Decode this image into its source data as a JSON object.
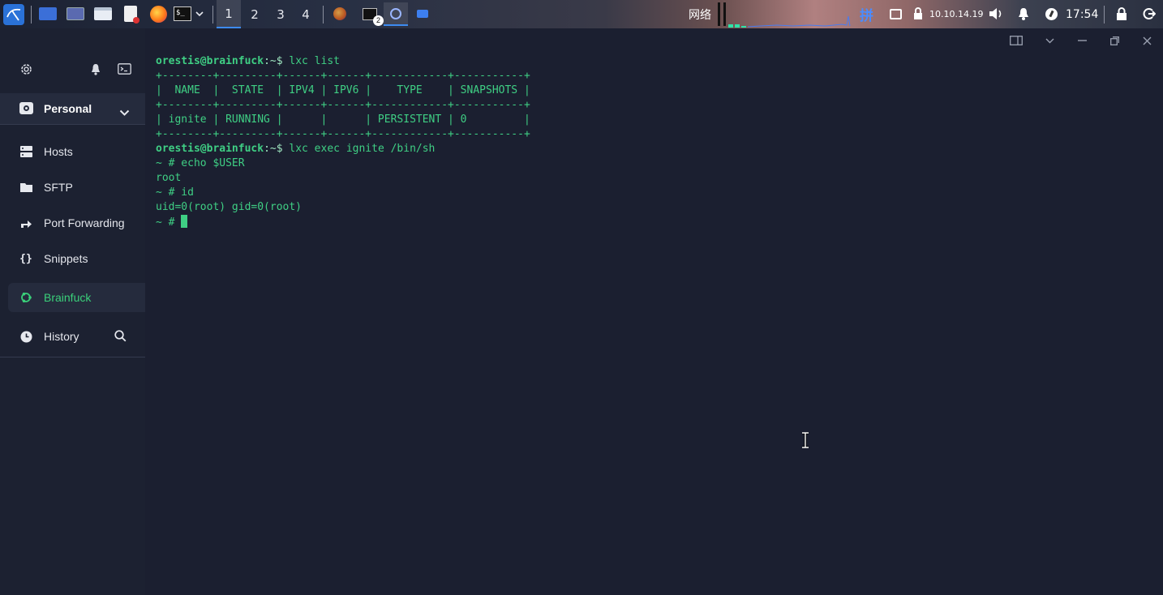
{
  "taskbar": {
    "workspaces": [
      "1",
      "2",
      "3",
      "4"
    ],
    "active_workspace": "1",
    "terminal_badge": "2",
    "network_label": "网络",
    "input_method": "拼",
    "ip_address": "10.10.14.19",
    "clock": "17:54"
  },
  "sidebar": {
    "vault_label": "Personal",
    "items": [
      {
        "label": "Hosts",
        "icon": "hosts-icon"
      },
      {
        "label": "SFTP",
        "icon": "folder-icon"
      },
      {
        "label": "Port Forwarding",
        "icon": "port-forwarding-icon"
      },
      {
        "label": "Snippets",
        "icon": "braces-icon"
      },
      {
        "label": "Brainfuck",
        "icon": "ubuntu-icon"
      },
      {
        "label": "History",
        "icon": "clock-icon"
      }
    ],
    "active_item": "Brainfuck"
  },
  "terminal": {
    "prompt_user": "orestis@brainfuck",
    "prompt_path": ":~$ ",
    "cmd1": "lxc list",
    "table_border": "+--------+---------+------+------+------------+-----------+",
    "table_header": "|  NAME  |  STATE  | IPV4 | IPV6 |    TYPE    | SNAPSHOTS |",
    "table_row": "| ignite | RUNNING |      |      | PERSISTENT | 0         |",
    "cmd2": "lxc exec ignite /bin/sh",
    "line_echo": "~ # echo $USER",
    "line_root": "root",
    "line_id": "~ # id",
    "line_uid": "uid=0(root) gid=0(root)",
    "line_prompt": "~ # "
  },
  "colors": {
    "terminal_bg": "#1b1f30",
    "terminal_fg": "#3fcf84",
    "sidebar_bg": "#1c2131",
    "accent_green": "#3ad07a"
  }
}
